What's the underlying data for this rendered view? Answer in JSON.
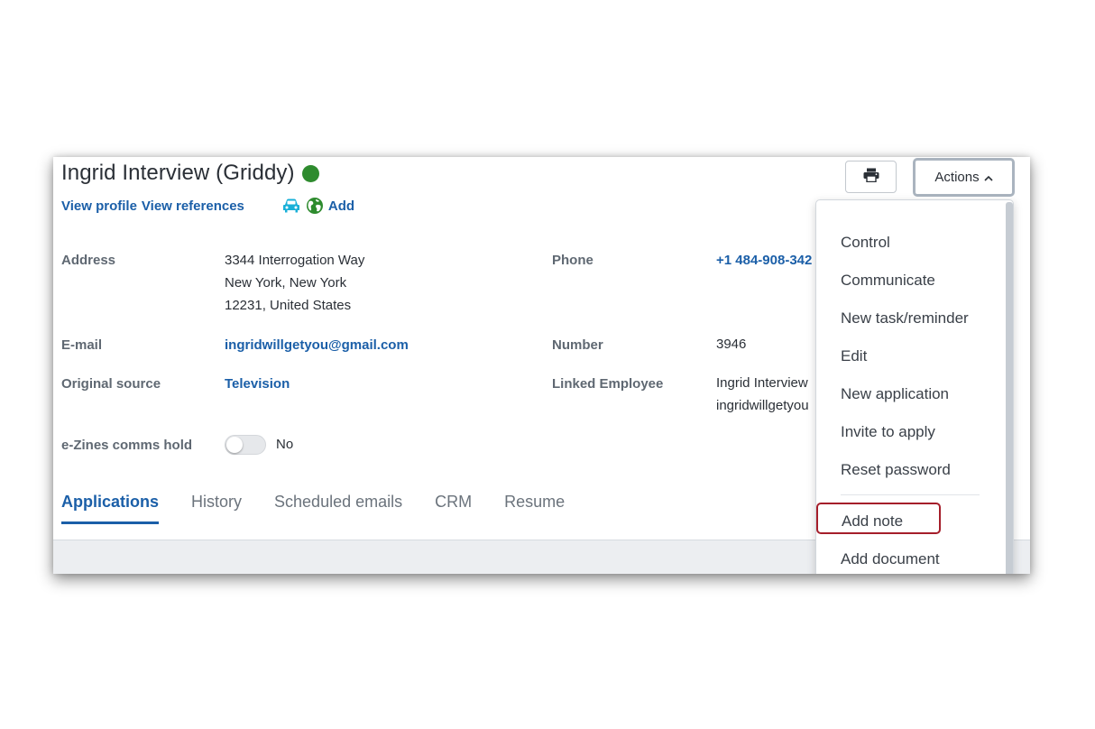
{
  "profile": {
    "name": "Ingrid Interview (Griddy)",
    "status_color": "#2e8b2e",
    "links": {
      "view_profile": "View profile",
      "view_references": "View references",
      "add": "Add"
    }
  },
  "fields": {
    "address": {
      "label": "Address",
      "lines": [
        "3344 Interrogation Way",
        "New York, New York",
        "12231, United States"
      ]
    },
    "phone": {
      "label": "Phone",
      "value": "+1 484-908-342"
    },
    "email": {
      "label": "E-mail",
      "value": "ingridwillgetyou@gmail.com"
    },
    "number": {
      "label": "Number",
      "value": "3946"
    },
    "original_source": {
      "label": "Original source",
      "value": "Television"
    },
    "linked_employee": {
      "label": "Linked Employee",
      "lines": [
        "Ingrid Interview",
        "ingridwillgetyou"
      ]
    },
    "ezines": {
      "label": "e-Zines comms hold",
      "value": "No",
      "toggle_on": false
    }
  },
  "tabs": [
    {
      "label": "Applications",
      "active": true
    },
    {
      "label": "History",
      "active": false
    },
    {
      "label": "Scheduled emails",
      "active": false
    },
    {
      "label": "CRM",
      "active": false
    },
    {
      "label": "Resume",
      "active": false
    }
  ],
  "toolbar": {
    "print_icon": "printer-icon",
    "actions_label": "Actions",
    "actions_chevron_icon": "chevron-up-icon"
  },
  "actions_menu": {
    "items": [
      "Control",
      "Communicate",
      "New task/reminder",
      "Edit",
      "New application",
      "Invite to apply",
      "Reset password",
      "Add note",
      "Add document"
    ],
    "highlighted_item": "Add note",
    "highlight_color": "#a51e2a"
  },
  "colors": {
    "link": "#1b5fa8",
    "car_icon": "#1ab0d8",
    "globe_icon": "#2e8b2e"
  }
}
